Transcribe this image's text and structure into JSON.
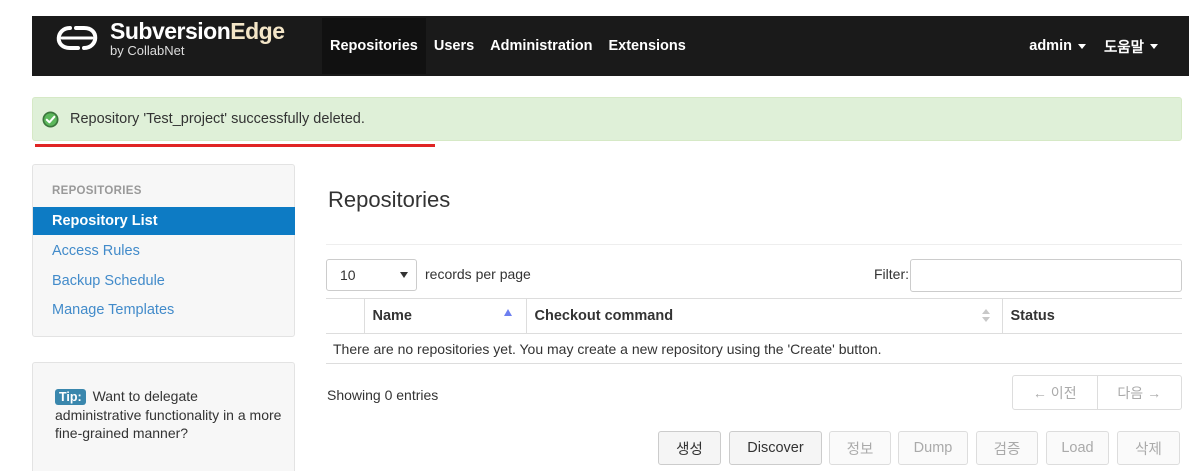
{
  "brand": {
    "name_part1": "Subversion",
    "name_part2": "Edge",
    "byline": "by CollabNet"
  },
  "nav": {
    "items": [
      {
        "label": "Repositories"
      },
      {
        "label": "Users"
      },
      {
        "label": "Administration"
      },
      {
        "label": "Extensions"
      }
    ],
    "user_menu": "admin",
    "help_menu": "도움말"
  },
  "alert": {
    "message": "Repository 'Test_project' successfully deleted."
  },
  "sidebar": {
    "header": "REPOSITORIES",
    "items": [
      {
        "label": "Repository List"
      },
      {
        "label": "Access Rules"
      },
      {
        "label": "Backup Schedule"
      },
      {
        "label": "Manage Templates"
      }
    ],
    "tip_badge": "Tip:",
    "tip_text": "Want to delegate administrative functionality in a more fine-grained manner?"
  },
  "main": {
    "title": "Repositories",
    "page_length": "10",
    "records_label": "records per page",
    "filter_label": "Filter:",
    "filter_value": "",
    "columns": [
      "",
      "Name",
      "Checkout command",
      "Status"
    ],
    "empty_message": "There are no repositories yet. You may create a new repository using the 'Create' button.",
    "info": "Showing 0 entries",
    "pager": {
      "prev": "← 이전",
      "next": "다음 →"
    },
    "buttons": {
      "create": "생성",
      "discover": "Discover",
      "info": "정보",
      "dump": "Dump",
      "verify": "검증",
      "load": "Load",
      "delete": "삭제"
    }
  },
  "colors": {
    "navbar": "#1a1a1a",
    "active_side": "#0d7bc4",
    "alert_bg": "#dff0d8",
    "link": "#428bca"
  }
}
